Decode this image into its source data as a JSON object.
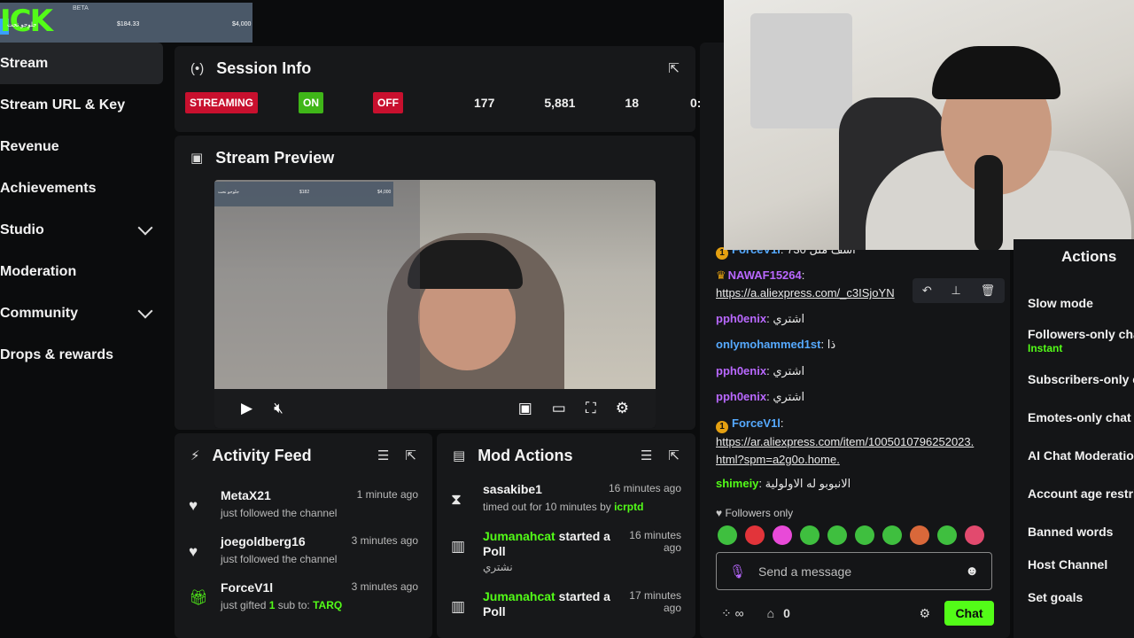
{
  "goal_bar": {
    "logo": "ICK",
    "beta": "BETA",
    "name": "جلوجو نحت",
    "current": "$184.33",
    "target": "$4,000"
  },
  "sidebar": {
    "items": [
      {
        "label": "Stream",
        "active": true,
        "expandable": false
      },
      {
        "label": "Stream URL & Key",
        "active": false,
        "expandable": false
      },
      {
        "label": "Revenue",
        "active": false,
        "expandable": false
      },
      {
        "label": "Achievements",
        "active": false,
        "expandable": false
      },
      {
        "label": "Studio",
        "active": false,
        "expandable": true
      },
      {
        "label": "Moderation",
        "active": false,
        "expandable": false
      },
      {
        "label": "Community",
        "active": false,
        "expandable": true
      },
      {
        "label": "Drops & rewards",
        "active": false,
        "expandable": false
      }
    ]
  },
  "session": {
    "title": "Session Info",
    "status_label": "STREAMING",
    "on_label": "ON",
    "off_label": "OFF",
    "stats": [
      "177",
      "5,881",
      "18",
      "0:"
    ]
  },
  "preview": {
    "title": "Stream Preview",
    "overlay_name": "جلوجو نحت",
    "overlay_mid": "$182",
    "overlay_end": "$4,000"
  },
  "activity": {
    "title": "Activity Feed",
    "items": [
      {
        "icon": "heart-icon",
        "name": "MetaX21",
        "time": "1 minute ago",
        "sub": "just followed the channel"
      },
      {
        "icon": "heart-icon",
        "name": "joegoldberg16",
        "time": "3 minutes ago",
        "sub": "just followed the channel"
      },
      {
        "icon": "gift-icon",
        "name": "ForceV1l",
        "time": "3 minutes ago",
        "sub_prefix": "just gifted ",
        "sub_count": "1",
        "sub_mid": " sub to: ",
        "sub_target": "TARQ"
      }
    ]
  },
  "mod": {
    "title": "Mod Actions",
    "items": [
      {
        "name": "sasakibe1",
        "time": "16 minutes ago",
        "sub_prefix": "timed out for 10 minutes by ",
        "sub_by": "icrptd"
      },
      {
        "name": "Jumanahcat",
        "action": " started a Poll",
        "time": "16 minutes ago",
        "sub": "نشتري"
      },
      {
        "name": "Jumanahcat",
        "action": " started a Poll",
        "time": "17 minutes ago",
        "sub": ""
      }
    ]
  },
  "chat": {
    "messages": [
      {
        "user": "ForceV1l",
        "text": "آسف مثل 730"
      },
      {
        "user": "NAWAF15264",
        "link": "https://a.aliexpress.com/_c3ISjoYN"
      },
      {
        "user": "pph0enix",
        "text": "اشتري"
      },
      {
        "user": "onlymohammed1st",
        "text": "ذا"
      },
      {
        "user": "pph0enix",
        "text": "اشتري"
      },
      {
        "user": "pph0enix",
        "text": "اشتري"
      },
      {
        "user": "ForceV1l",
        "link1": "https://ar.aliexpress.com/item/1005010796252023.",
        "link2": "html?spm=a2g0o.home."
      },
      {
        "user": "shimeiy",
        "text": "الانبوبو له الاولولية"
      }
    ],
    "badge_num": "1",
    "followers_only": "Followers only",
    "input_placeholder": "Send a message",
    "bottom_count": "0",
    "chat_button": "Chat"
  },
  "actions": {
    "title": "Actions",
    "items": [
      "Slow mode",
      "Followers-only cha",
      "Subscribers-only c",
      "Emotes-only chat",
      "AI Chat Moderatio",
      "Account age restri",
      "Banned words",
      "Host Channel",
      "Set goals"
    ],
    "followers_sub": "Instant"
  },
  "colors": {
    "accent": "#53fc18",
    "streaming": "#c8102e",
    "on": "#3fb618",
    "purple_user": "#b968ff",
    "blue_user": "#56aaff"
  }
}
